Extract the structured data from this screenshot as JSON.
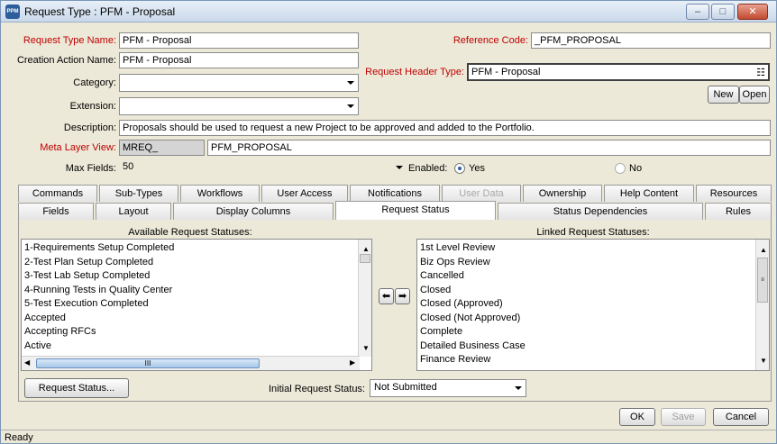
{
  "window": {
    "title": "Request Type : PFM - Proposal",
    "app_icon": "PPM"
  },
  "form": {
    "request_type_name": {
      "label": "Request Type Name:",
      "value": "PFM - Proposal"
    },
    "reference_code": {
      "label": "Reference Code:",
      "value": "_PFM_PROPOSAL"
    },
    "creation_action_name": {
      "label": "Creation Action Name:",
      "value": "PFM - Proposal"
    },
    "request_header_type": {
      "label": "Request Header Type:",
      "value": "PFM - Proposal"
    },
    "category": {
      "label": "Category:",
      "value": ""
    },
    "extension": {
      "label": "Extension:",
      "value": ""
    },
    "new_label": "New",
    "open_label": "Open",
    "description": {
      "label": "Description:",
      "value": "Proposals should be used to request a new Project to be approved and added to the Portfolio."
    },
    "meta_layer_view": {
      "label": "Meta Layer View:",
      "prefix": "MREQ_",
      "value": "PFM_PROPOSAL"
    },
    "max_fields": {
      "label": "Max Fields:",
      "value": "50"
    },
    "enabled": {
      "label": "Enabled:",
      "yes": "Yes",
      "no": "No",
      "selected": "Yes"
    }
  },
  "tabs_row1": [
    "Commands",
    "Sub-Types",
    "Workflows",
    "User Access",
    "Notifications",
    "User Data",
    "Ownership",
    "Help Content",
    "Resources"
  ],
  "tabs_row2": [
    "Fields",
    "Layout",
    "Display Columns",
    "Request Status",
    "Status Dependencies",
    "Rules"
  ],
  "active_tab": "Request Status",
  "available": {
    "header": "Available Request Statuses:",
    "items": [
      "1-Requirements Setup Completed",
      "2-Test Plan Setup Completed",
      "3-Test Lab Setup Completed",
      "4-Running Tests in Quality Center",
      "5-Test Execution Completed",
      "Accepted",
      "Accepting RFCs",
      "Active"
    ]
  },
  "linked": {
    "header": "Linked Request Statuses:",
    "items": [
      "1st Level Review",
      "Biz Ops Review",
      "Cancelled",
      "Closed",
      "Closed (Approved)",
      "Closed (Not Approved)",
      "Complete",
      "Detailed Business Case",
      "Finance Review"
    ]
  },
  "request_status_button": "Request Status...",
  "initial_status": {
    "label": "Initial Request Status:",
    "value": "Not Submitted"
  },
  "footer": {
    "ok": "OK",
    "save": "Save",
    "cancel": "Cancel"
  },
  "status_bar": "Ready"
}
